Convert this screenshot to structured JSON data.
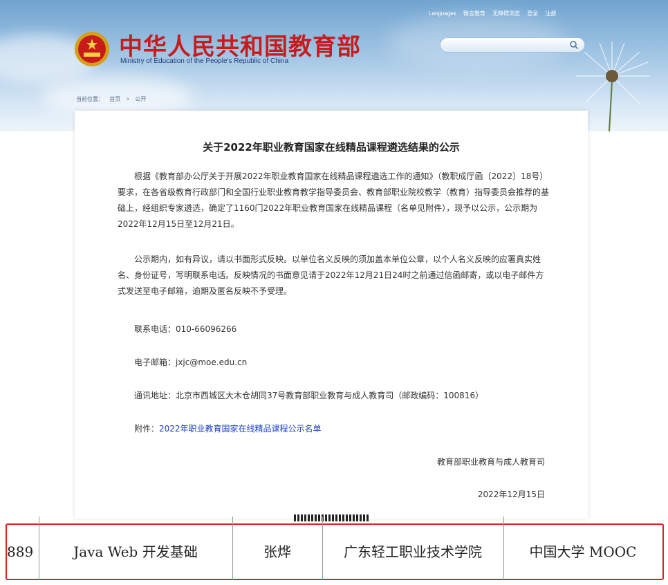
{
  "header": {
    "title_cn": "中华人民共和国教育部",
    "title_en": "Ministry of Education of the People's Republic of China",
    "top_links": [
      "Languages",
      "微言教育",
      "无障碍浏览",
      "登录",
      "注册"
    ],
    "search_placeholder": ""
  },
  "breadcrumb": [
    "当前位置：",
    "首页",
    "公开"
  ],
  "article": {
    "title": "关于2022年职业教育国家在线精品课程遴选结果的公示",
    "para1": "根据《教育部办公厅关于开展2022年职业教育国家在线精品课程遴选工作的通知》（教职成厅函〔2022〕18号）要求，在各省级教育行政部门和全国行业职业教育教学指导委员会、教育部职业院校教学（教育）指导委员会推荐的基础上，经组织专家遴选，确定了1160门2022年职业教育国家在线精品课程（名单见附件），现予以公示，公示期为2022年12月15日至12月21日。",
    "para2": "公示期内，如有异议，请以书面形式反映。以单位名义反映的须加盖本单位公章，以个人名义反映的应署真实姓名、身份证号，写明联系电话。反映情况的书面意见请于2022年12月21日24时之前通过信函邮寄，或以电子邮件方式发送至电子邮箱，逾期及匿名反映不予受理。",
    "phone": "联系电话：010-66096266",
    "email": "电子邮箱：jxjc@moe.edu.cn",
    "address": "通讯地址：北京市西城区大木仓胡同37号教育部职业教育与成人教育司（邮政编码：100816）",
    "attachment_label": "附件：",
    "attachment_link": "2022年职业教育国家在线精品课程公示名单",
    "signer": "教育部职业教育与成人教育司",
    "date": "2022年12月15日"
  },
  "highlight_row": {
    "no": "889",
    "course": "Java Web 开发基础",
    "leader": "张烨",
    "school": "广东轻工职业技术学院",
    "platform": "中国大学 MOOC"
  },
  "colors": {
    "title_red": "#c81b1b",
    "link_blue": "#1a3ec8",
    "highlight_border": "#e02020"
  }
}
